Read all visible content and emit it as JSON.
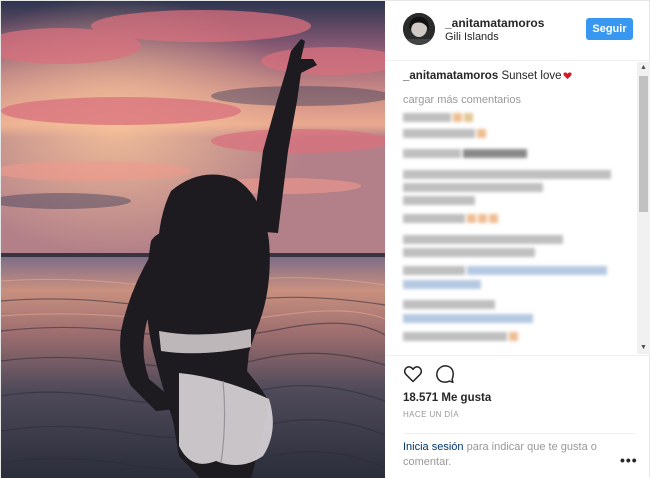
{
  "header": {
    "username": "_anitamatamoros",
    "location": "Gili Islands",
    "follow_label": "Seguir"
  },
  "caption": {
    "user": "_anitamatamoros",
    "text": "Sunset love",
    "emoji": "heart-emoji"
  },
  "comments": {
    "load_more": "cargar más comentarios"
  },
  "actions": {
    "likes": "18.571 Me gusta",
    "time": "HACE UN DÍA",
    "login_link": "Inicia sesión",
    "login_rest": "para indicar que te gusta o comentar.",
    "more_label": "•••"
  },
  "icons": [
    "heart-icon",
    "comment-icon",
    "more-icon",
    "scroll-up-arrow",
    "scroll-down-arrow"
  ],
  "colors": {
    "accent": "#3897f0",
    "link": "#003569",
    "muted": "#999999"
  }
}
